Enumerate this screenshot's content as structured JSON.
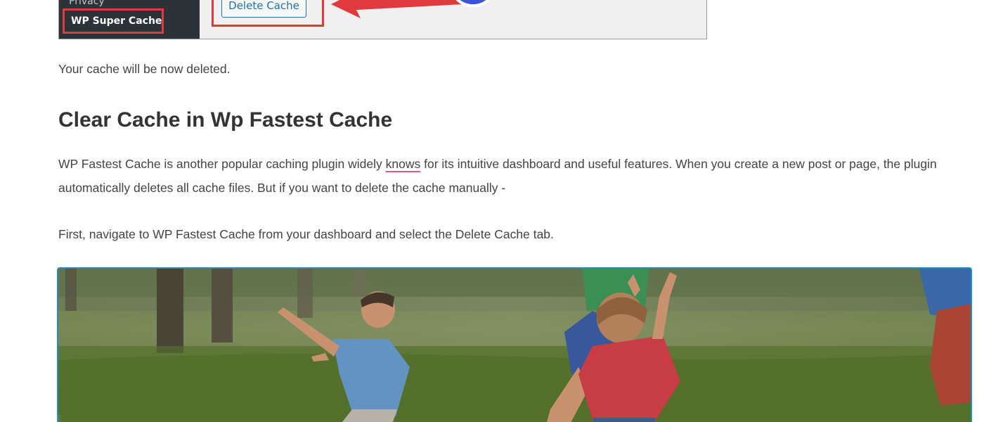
{
  "screenshot": {
    "sidebar_item_above": "Privacy",
    "sidebar_item_active": "WP Super Cache",
    "delete_button_label": "Delete Cache",
    "callout_color": "#e03a3e",
    "button_color": "#2271b1"
  },
  "article": {
    "after_screenshot_text": "Your cache will be now deleted.",
    "section_heading": "Clear Cache in Wp Fastest Cache",
    "intro_before": "WP Fastest Cache is another popular caching plugin widely ",
    "intro_misspelled_word": "knows",
    "intro_after": " for its intuitive dashboard and useful features. When you create a new post or page, the plugin automatically deletes all cache files. But if you want to delete the cache manually -",
    "step_text": "First, navigate to WP Fastest Cache from your dashboard and select the Delete Cache tab."
  },
  "image": {
    "subject": "children-playing-on-grass-photo",
    "selected": true,
    "selection_color": "#1e8cc7"
  }
}
